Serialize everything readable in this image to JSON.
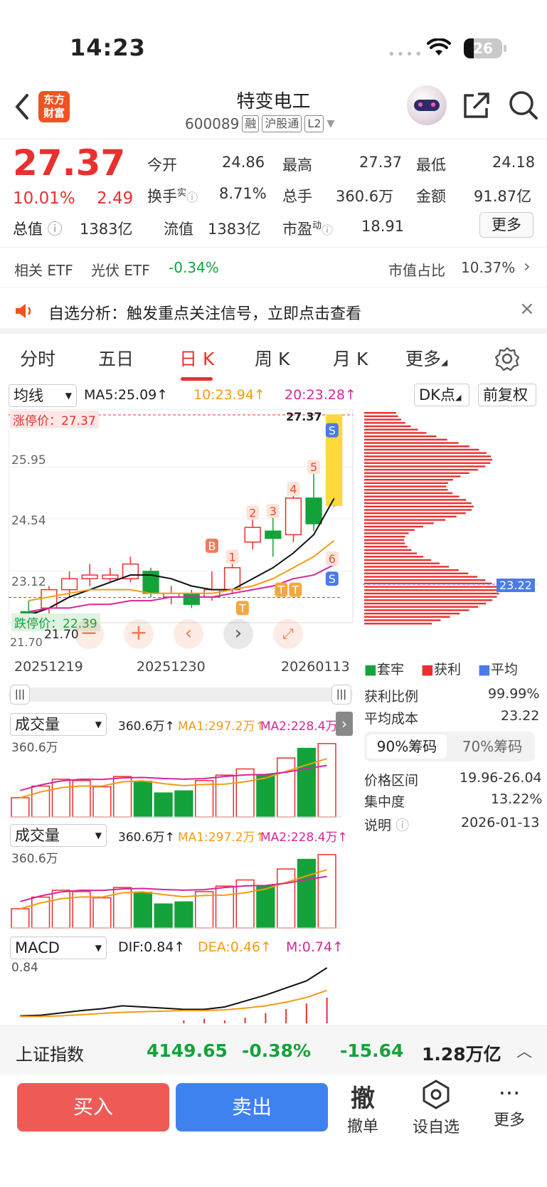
{
  "status_bar": {
    "time": "14:23",
    "battery": "26"
  },
  "nav": {
    "logo_line1": "东方",
    "logo_line2": "财富",
    "name": "特变电工",
    "code": "600089",
    "tags": [
      "融",
      "沪股通",
      "L2"
    ]
  },
  "quote": {
    "price": "27.37",
    "change_pct": "10.01%",
    "change": "2.49",
    "open_label": "今开",
    "open": "24.86",
    "high_label": "最高",
    "high": "27.37",
    "low_label": "最低",
    "low": "24.18",
    "turnover_label": "换手",
    "turnover_sup": "实",
    "turnover": "8.71%",
    "volume_label": "总手",
    "volume": "360.6万",
    "amount_label": "金额",
    "amount": "91.87亿",
    "mcap_label": "总值",
    "mcap": "1383亿",
    "float_label": "流值",
    "float": "1383亿",
    "pe_label": "市盈",
    "pe_sup": "动",
    "pe": "18.91",
    "more": "更多"
  },
  "etf": {
    "label": "相关 ETF",
    "name": "光伏 ETF",
    "change": "-0.34%",
    "share_label": "市值占比",
    "share": "10.37%"
  },
  "notice": {
    "text": "自选分析：触发重点关注信号，立即点击查看"
  },
  "tabs": [
    "分时",
    "五日",
    "日 K",
    "周 K",
    "月 K",
    "更多"
  ],
  "kline": {
    "indicator": "均线",
    "ma5": "MA5:25.09↑",
    "ma10": "10:23.94↑",
    "ma20": "20:23.28↑",
    "dk": "DK点",
    "adjust": "前复权",
    "limit_up": "涨停价：27.37",
    "limit_down": "跌停价：22.39",
    "y_labels": [
      "25.95",
      "24.54",
      "23.12"
    ],
    "top_price": "27.37",
    "low_price": "21.70",
    "bottom_label": "21.70",
    "dates": [
      "20251219",
      "20251230",
      "20260113"
    ],
    "marks": [
      "B",
      "1",
      "2",
      "3",
      "4",
      "5",
      "6",
      "S",
      "S",
      "T",
      "T",
      "T"
    ],
    "chip_avg": "23.22"
  },
  "chart_data": {
    "type": "candlestick",
    "dates_shown": [
      "20251219",
      "20251230",
      "20260113"
    ],
    "candles": [
      {
        "o": 22.0,
        "c": 21.8,
        "h": 22.3,
        "l": 21.7
      },
      {
        "o": 22.1,
        "c": 22.6,
        "h": 22.7,
        "l": 21.9
      },
      {
        "o": 22.6,
        "c": 22.9,
        "h": 23.1,
        "l": 22.4
      },
      {
        "o": 22.9,
        "c": 23.0,
        "h": 23.3,
        "l": 22.7
      },
      {
        "o": 22.9,
        "c": 23.0,
        "h": 23.2,
        "l": 22.8
      },
      {
        "o": 22.9,
        "c": 23.3,
        "h": 23.5,
        "l": 22.8
      },
      {
        "o": 23.1,
        "c": 22.5,
        "h": 23.2,
        "l": 22.4
      },
      {
        "o": 22.4,
        "c": 22.5,
        "h": 22.7,
        "l": 22.2
      },
      {
        "o": 22.5,
        "c": 22.2,
        "h": 22.6,
        "l": 22.1
      },
      {
        "o": 22.4,
        "c": 22.6,
        "h": 23.1,
        "l": 22.3
      },
      {
        "o": 22.6,
        "c": 23.2,
        "h": 23.3,
        "l": 22.5
      },
      {
        "o": 23.9,
        "c": 24.3,
        "h": 24.6,
        "l": 23.7
      },
      {
        "o": 24.2,
        "c": 24.0,
        "h": 24.6,
        "l": 23.5
      },
      {
        "o": 24.1,
        "c": 25.1,
        "h": 25.4,
        "l": 23.9
      },
      {
        "o": 25.1,
        "c": 24.4,
        "h": 25.9,
        "l": 24.2
      },
      {
        "o": 24.9,
        "c": 27.37,
        "h": 27.37,
        "l": 24.86
      }
    ],
    "ma_lines": [
      {
        "name": "MA5",
        "values": [
          21.9,
          22.1,
          22.4,
          22.6,
          22.8,
          23.0,
          23.0,
          22.9,
          22.7,
          22.6,
          22.6,
          22.9,
          23.2,
          23.6,
          24.1,
          25.09
        ]
      },
      {
        "name": "MA10",
        "values": [
          22.3,
          22.4,
          22.5,
          22.6,
          22.6,
          22.6,
          22.5,
          22.5,
          22.5,
          22.5,
          22.6,
          22.7,
          22.9,
          23.2,
          23.5,
          23.94
        ]
      },
      {
        "name": "MA20",
        "values": [
          22.0,
          22.1,
          22.1,
          22.2,
          22.2,
          22.3,
          22.3,
          22.4,
          22.4,
          22.4,
          22.5,
          22.6,
          22.7,
          22.9,
          23.0,
          23.28
        ]
      }
    ],
    "ylim": [
      21.7,
      27.37
    ]
  },
  "chips": {
    "legend": [
      "套牢",
      "获利",
      "平均"
    ],
    "profit_ratio_label": "获利比例",
    "profit_ratio": "99.99%",
    "avg_cost_label": "平均成本",
    "avg_cost": "23.22",
    "tab1": "90%筹码",
    "tab2": "70%筹码",
    "range_label": "价格区间",
    "range": "19.96-26.04",
    "concentration_label": "集中度",
    "concentration": "13.22%",
    "note_label": "说明",
    "date": "2026-01-13"
  },
  "volume1": {
    "title": "成交量",
    "value": "360.6万↑",
    "ma1": "MA1:297.2万↑",
    "ma2": "MA2:228.4万",
    "top": "360.6万",
    "bars": [
      0.28,
      0.45,
      0.55,
      0.53,
      0.44,
      0.59,
      0.52,
      0.35,
      0.38,
      0.53,
      0.61,
      0.7,
      0.62,
      0.86,
      1.0,
      1.07
    ]
  },
  "volume2": {
    "title": "成交量",
    "value": "360.6万↑",
    "ma1": "MA1:297.2万↑",
    "ma2": "MA2:228.4万↑",
    "top": "360.6万"
  },
  "macd": {
    "title": "MACD",
    "dif": "DIF:0.84↑",
    "dea": "DEA:0.46↑",
    "m": "M:0.74↑",
    "top": "0.84"
  },
  "index_bar": {
    "name": "上证指数",
    "value": "4149.65",
    "pct": "-0.38%",
    "change": "-15.64",
    "amount": "1.28万亿"
  },
  "actions": {
    "buy": "买入",
    "sell": "卖出",
    "cancel_icon": "撤",
    "cancel": "撤单",
    "watch": "设自选",
    "more": "更多"
  }
}
